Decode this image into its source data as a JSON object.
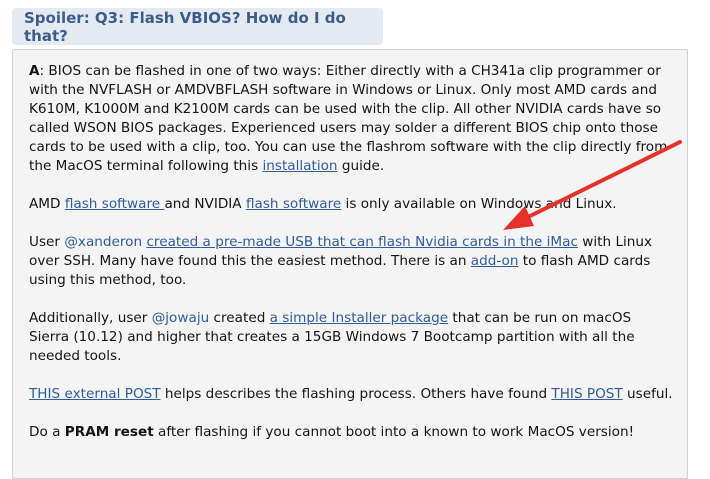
{
  "spoiler": {
    "title": "Spoiler: Q3: Flash VBIOS? How do I do that?"
  },
  "p1": {
    "label": "A",
    "text": ": BIOS can be flashed in one of two ways: Either directly with a CH341a clip programmer or with the NVFLASH or AMDVBFLASH software in Windows or Linux. Only most AMD cards and K610M, K1000M and K2100M cards can be used with the clip. All other NVIDIA cards have so called WSON BIOS packages. Experienced users may solder a different BIOS chip onto those cards to be used with a clip, too. You can use the flashrom software with the clip directly from the MacOS terminal following this ",
    "link": "installation",
    "tail": " guide."
  },
  "p2": {
    "t1": "AMD ",
    "link1": "flash software ",
    "t2": "and NVIDIA ",
    "link2": "flash software",
    "t3": " is only available on Windows and Linux."
  },
  "p3": {
    "t1": "User ",
    "user": "@xanderon",
    "t2": " ",
    "link1": "created a pre-made USB that can flash Nvidia cards in the iMac",
    "t3": " with Linux over SSH. Many have found this the easiest method. There is an ",
    "link2": "add-on",
    "t4": " to flash AMD cards using this method, too."
  },
  "p4": {
    "t1": "Additionally, user ",
    "user": "@jowaju",
    "t2": " created ",
    "link1": "a simple Installer package",
    "t3": " that can be run on macOS Sierra (10.12) and higher that creates a 15GB Windows 7 Bootcamp partition with all the needed tools."
  },
  "p5": {
    "link1": "THIS external POST",
    "t1": " helps describes the flashing process. Others have found ",
    "link2": "THIS POST",
    "t2": " useful."
  },
  "p6": {
    "t1": "Do a ",
    "bold": "PRAM reset",
    "t2": " after flashing if you cannot boot into a known to work MacOS version!"
  },
  "colors": {
    "link": "#2f5d9a",
    "spoiler_bg": "#e4eaf2",
    "spoiler_text": "#3b5d8a",
    "arrow": "#e8302a",
    "body_bg": "#f4f4f4"
  }
}
